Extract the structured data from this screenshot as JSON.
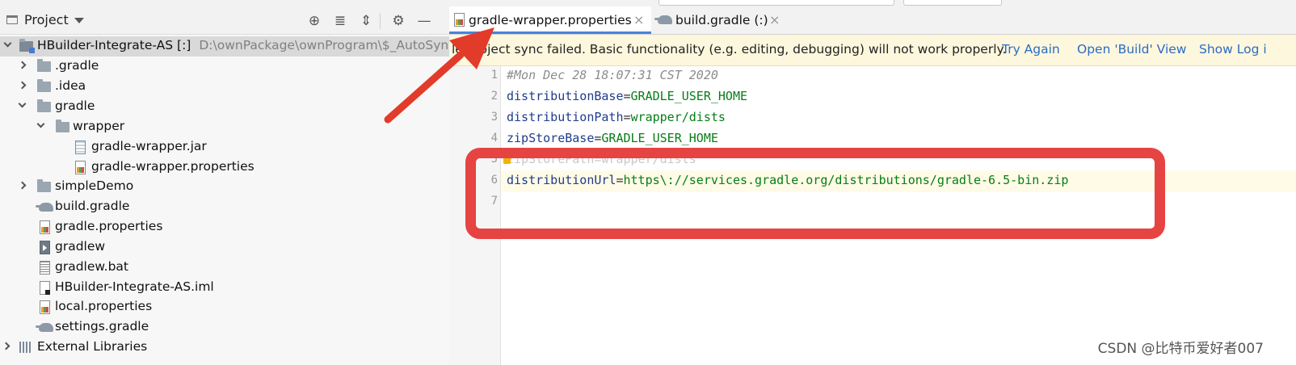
{
  "project_panel": {
    "title": "Project",
    "header_icons": [
      "locate-icon",
      "expand-all-icon",
      "collapse-all-icon",
      "gear-icon",
      "hide-icon"
    ],
    "tree": [
      {
        "label": "HBuilder-Integrate-AS [:]",
        "path": "D:\\ownPackage\\ownProgram\\$_AutoSyncA",
        "icon": "module-folder-icon",
        "expanded": true,
        "selected": true
      },
      {
        "label": ".gradle",
        "icon": "folder-icon",
        "expanded": false
      },
      {
        "label": ".idea",
        "icon": "folder-icon",
        "expanded": false
      },
      {
        "label": "gradle",
        "icon": "folder-icon",
        "expanded": true
      },
      {
        "label": "wrapper",
        "icon": "folder-icon",
        "expanded": true
      },
      {
        "label": "gradle-wrapper.jar",
        "icon": "jar-file-icon"
      },
      {
        "label": "gradle-wrapper.properties",
        "icon": "properties-file-icon"
      },
      {
        "label": "simpleDemo",
        "icon": "folder-icon",
        "expanded": false
      },
      {
        "label": "build.gradle",
        "icon": "gradle-elephant-icon"
      },
      {
        "label": "gradle.properties",
        "icon": "properties-file-icon"
      },
      {
        "label": "gradlew",
        "icon": "shell-file-icon"
      },
      {
        "label": "gradlew.bat",
        "icon": "text-file-icon"
      },
      {
        "label": "HBuilder-Integrate-AS.iml",
        "icon": "iml-file-icon"
      },
      {
        "label": "local.properties",
        "icon": "properties-file-icon"
      },
      {
        "label": "settings.gradle",
        "icon": "gradle-elephant-icon"
      },
      {
        "label": "External Libraries",
        "icon": "libraries-icon",
        "expanded": false
      }
    ]
  },
  "tabs": [
    {
      "label": "gradle-wrapper.properties",
      "active": true,
      "icon": "properties-file-icon"
    },
    {
      "label": "build.gradle (:)",
      "active": false,
      "icon": "gradle-elephant-icon"
    }
  ],
  "notification": {
    "message": "le project sync failed. Basic functionality (e.g. editing, debugging) will not work properly.",
    "links": [
      "Try Again",
      "Open 'Build' View",
      "Show Log i"
    ]
  },
  "editor": {
    "line_numbers": [
      "1",
      "2",
      "3",
      "4",
      "5",
      "6",
      "7"
    ],
    "lines": [
      {
        "comment": "#Mon Dec 28 18:07:31 CST 2020"
      },
      {
        "key": "distributionBase",
        "value": "GRADLE_USER_HOME"
      },
      {
        "key": "distributionPath",
        "value": "wrapper/dists"
      },
      {
        "key": "zipStoreBase",
        "value": "GRADLE_USER_HOME"
      },
      {
        "key": "zipStorePath",
        "value": "wrapper/dists"
      },
      {
        "key": "distributionUrl",
        "value": "https\\://services.gradle.org/distributions/gradle-6.5-bin.zip"
      }
    ]
  },
  "annotations": {
    "highlight_color": "#e64343",
    "arrow_color": "#e23b2a"
  },
  "watermark": "CSDN @比特币爱好者007"
}
